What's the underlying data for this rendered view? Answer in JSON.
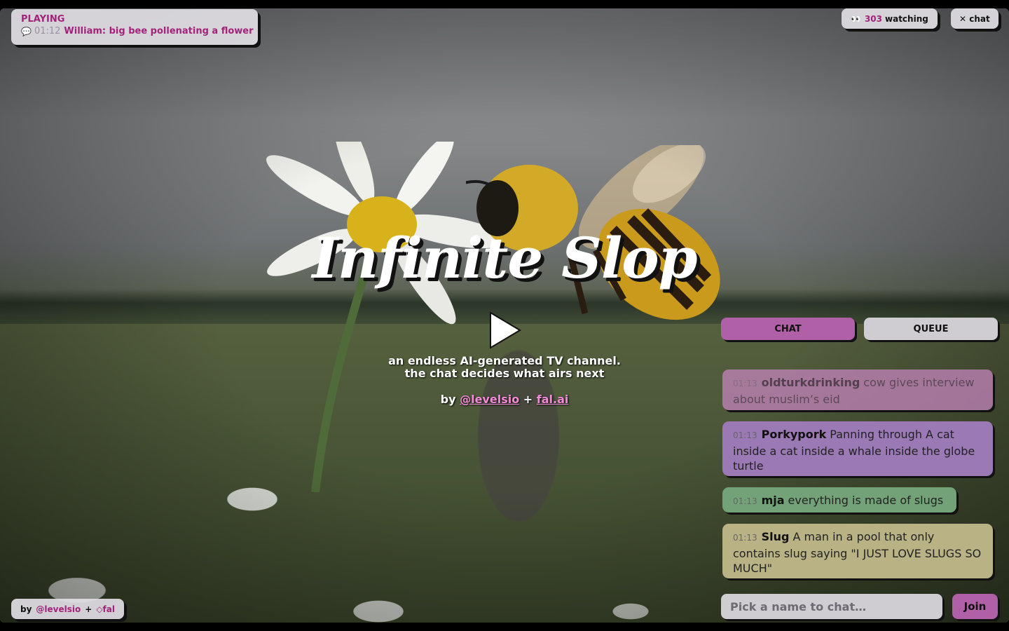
{
  "now_playing": {
    "status": "PLAYING",
    "time": "01:12",
    "title": "William: big bee pollenating a flower"
  },
  "header": {
    "watching_count": "303",
    "watching_label": "watching",
    "close_chat_label": "✕ chat"
  },
  "hero": {
    "title": "Infinite Slop",
    "tagline_line1": "an endless AI-generated TV channel.",
    "tagline_line2": "the chat decides what airs next",
    "by_label": "by",
    "link1": "@levelsio",
    "plus": "+",
    "link2": "fal.ai"
  },
  "tabs": {
    "chat": "CHAT",
    "queue": "QUEUE"
  },
  "chat": {
    "messages": [
      {
        "time": "01:13",
        "user": "oldturkdrinking",
        "text": "cow gives interview about muslim’s eid"
      },
      {
        "time": "01:13",
        "user": "Porkypork",
        "text": "Panning through A cat inside a cat inside a whale inside the globe turtle"
      },
      {
        "time": "01:13",
        "user": "mja",
        "text": "everything is made of slugs"
      },
      {
        "time": "01:13",
        "user": "Slug",
        "text": "A man in a pool that only contains slug saying \"I JUST LOVE SLUGS SO MUCH\""
      }
    ],
    "input_placeholder": "Pick a name to chat…",
    "join_label": "Join"
  },
  "credit": {
    "by": "by",
    "handle": "@levelsio",
    "plus": "+",
    "fal": "◇fal"
  },
  "colors": {
    "accent": "#a3237a",
    "chat_tab": "#b060a6",
    "queue_tab": "#cfcdd2"
  }
}
